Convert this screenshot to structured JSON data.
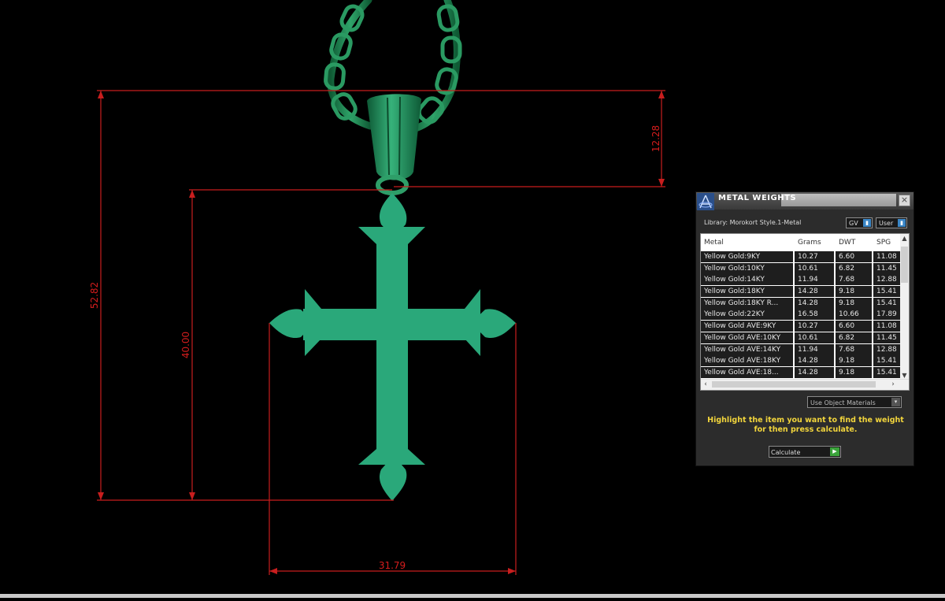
{
  "dimensions": {
    "total_height": "52.82",
    "bail_height": "12.28",
    "cross_height": "40.00",
    "cross_width": "31.79"
  },
  "colors": {
    "pendant": "#2aa87a",
    "chain": "#1e7a4c",
    "dimension_lines": "#c81e1e",
    "instruction_text": "#f2d53c"
  },
  "panel": {
    "title": "METAL WEIGHTS",
    "close_label": "×",
    "library_label": "Library: Morokort Style.1-Metal",
    "unit_select": "GV",
    "source_select": "User",
    "columns": [
      "Metal",
      "Grams",
      "DWT",
      "SPG"
    ],
    "rows": [
      {
        "metal": "Yellow Gold:9KY",
        "grams": "10.27",
        "dwt": "6.60",
        "spg": "11.08"
      },
      {
        "metal": "Yellow Gold:10KY",
        "grams": "10.61",
        "dwt": "6.82",
        "spg": "11.45"
      },
      {
        "metal": "Yellow Gold:14KY",
        "grams": "11.94",
        "dwt": "7.68",
        "spg": "12.88"
      },
      {
        "metal": "Yellow Gold:18KY",
        "grams": "14.28",
        "dwt": "9.18",
        "spg": "15.41"
      },
      {
        "metal": "Yellow Gold:18KY R...",
        "grams": "14.28",
        "dwt": "9.18",
        "spg": "15.41"
      },
      {
        "metal": "Yellow Gold:22KY",
        "grams": "16.58",
        "dwt": "10.66",
        "spg": "17.89"
      },
      {
        "metal": "Yellow Gold AVE:9KY",
        "grams": "10.27",
        "dwt": "6.60",
        "spg": "11.08"
      },
      {
        "metal": "Yellow Gold AVE:10KY",
        "grams": "10.61",
        "dwt": "6.82",
        "spg": "11.45"
      },
      {
        "metal": "Yellow Gold AVE:14KY",
        "grams": "11.94",
        "dwt": "7.68",
        "spg": "12.88"
      },
      {
        "metal": "Yellow Gold AVE:18KY",
        "grams": "14.28",
        "dwt": "9.18",
        "spg": "15.41"
      },
      {
        "metal": "Yellow Gold AVE:18...",
        "grams": "14.28",
        "dwt": "9.18",
        "spg": "15.41"
      }
    ],
    "use_object_materials": "Use Object Materials",
    "instruction": "Highlight the item you want to find the weight for then press calculate.",
    "calculate_label": "Calculate"
  }
}
